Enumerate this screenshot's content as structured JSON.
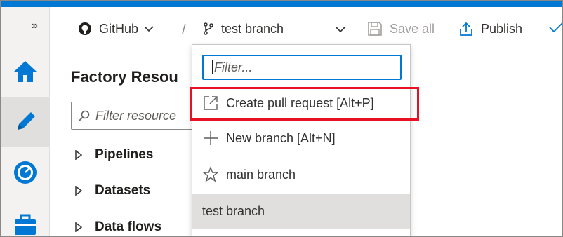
{
  "rail": {
    "expand_icon": "double-chevron-right-icon",
    "items": [
      {
        "icon": "home-icon",
        "active": false
      },
      {
        "icon": "pencil-icon",
        "active": true
      },
      {
        "icon": "monitor-gauge-icon",
        "active": false
      },
      {
        "icon": "toolbox-icon",
        "active": false
      }
    ]
  },
  "toolbar": {
    "repo_label": "GitHub",
    "separator": "/",
    "branch_label": "test branch",
    "save_all_label": "Save all",
    "publish_label": "Publish"
  },
  "panel": {
    "title": "Factory Resou",
    "search_placeholder": "Filter resource",
    "tree": [
      {
        "label": "Pipelines"
      },
      {
        "label": "Datasets"
      },
      {
        "label": "Data flows"
      }
    ]
  },
  "dropdown": {
    "filter_placeholder": "Filter...",
    "items": [
      {
        "label": "Create pull request [Alt+P]",
        "icon": "external-link-icon"
      },
      {
        "label": "New branch [Alt+N]",
        "icon": "plus-icon"
      },
      {
        "label": "main branch",
        "icon": "star-icon"
      },
      {
        "label": "test branch",
        "icon": "",
        "selected": true
      }
    ]
  },
  "colors": {
    "accent": "#0078d4",
    "highlight_border": "#e81123",
    "rail_background": "#f3f2f1"
  }
}
